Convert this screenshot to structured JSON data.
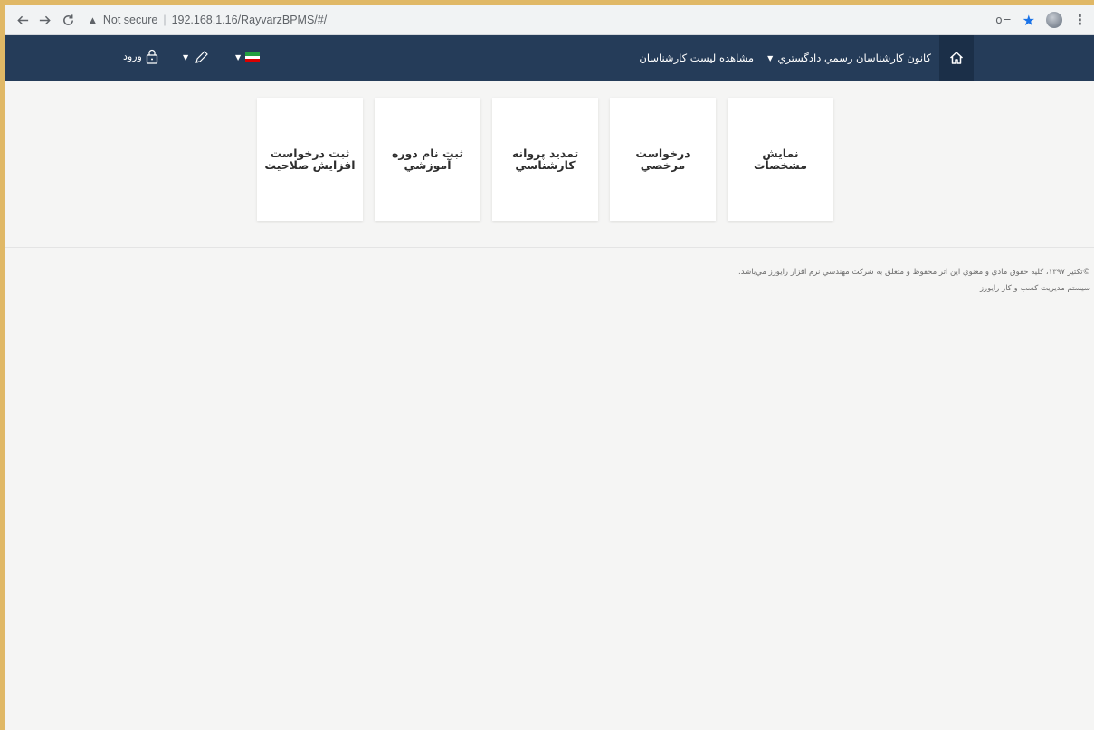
{
  "browser": {
    "security_label": "Not secure",
    "url": "192.168.1.16/RayvarzBPMS/#/"
  },
  "navbar": {
    "courts_menu": "كانون كارشناسان رسمي دادگستري",
    "experts_list": "مشاهده ليست كارشناسان",
    "login": "ورود",
    "colors": {
      "bar": "#253c59",
      "home_bg": "#1b2f48"
    }
  },
  "tiles": [
    {
      "label": "نمايش مشخصات"
    },
    {
      "label": "درخواست مرخصي"
    },
    {
      "label": "تمديد پروانه كارشناسي"
    },
    {
      "label": "ثبت نام دوره آموزشي"
    },
    {
      "label": "ثبت درخواست افزايش صلاحيت"
    }
  ],
  "footer": {
    "copyright": "©تكثير ۱۳۹۷، كليه حقوق مادي و معنوي اين اثر محفوظ و متعلق به شركت مهندسي نرم افزار رايورز مي‌باشد.",
    "system": "سيستم مديريت كسب و كار رايورز"
  },
  "icons": [
    "back-arrow-icon",
    "forward-arrow-icon",
    "reload-icon",
    "warning-icon",
    "key-icon",
    "star-icon",
    "profile-icon",
    "menu-dots-icon",
    "home-icon",
    "iran-flag-icon",
    "pen-icon",
    "lock-icon"
  ]
}
